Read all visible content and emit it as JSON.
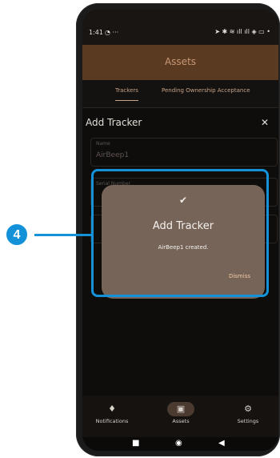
{
  "status_bar": {
    "time": "1:41",
    "left_icons": "◔ ···",
    "right_icons": "➤ ✱ ≋ ıll ıll ◈ ▭ •"
  },
  "app_bar": {
    "title": "Assets"
  },
  "tabs": [
    {
      "label": "Trackers",
      "active": true
    },
    {
      "label": "Pending Ownership Acceptance",
      "active": false
    }
  ],
  "sheet": {
    "title": "Add Tracker",
    "close_icon": "✕",
    "fields": [
      {
        "label": "Name",
        "value": "AirBeep1"
      },
      {
        "label": "Serial Number",
        "value": ""
      },
      {
        "label": "",
        "value": ""
      }
    ]
  },
  "dialog": {
    "icon": "check-circle",
    "icon_glyph": "✔",
    "title": "Add Tracker",
    "message": "AirBeep1 created.",
    "dismiss_label": "Dismiss"
  },
  "bottom_nav": [
    {
      "label": "Notifications",
      "icon": "bell-icon",
      "glyph": "🔔",
      "active": false
    },
    {
      "label": "Assets",
      "icon": "archive-icon",
      "glyph": "🗃",
      "active": true
    },
    {
      "label": "Settings",
      "icon": "gear-icon",
      "glyph": "⚙",
      "active": false
    }
  ],
  "system_nav": {
    "recents": "■",
    "home": "◉",
    "back": "◀"
  },
  "callout": {
    "number": "4",
    "color": "#1492d9"
  },
  "colors": {
    "app_bar": "#5b3a22",
    "dialog": "#766458",
    "accent": "#c9a386"
  }
}
